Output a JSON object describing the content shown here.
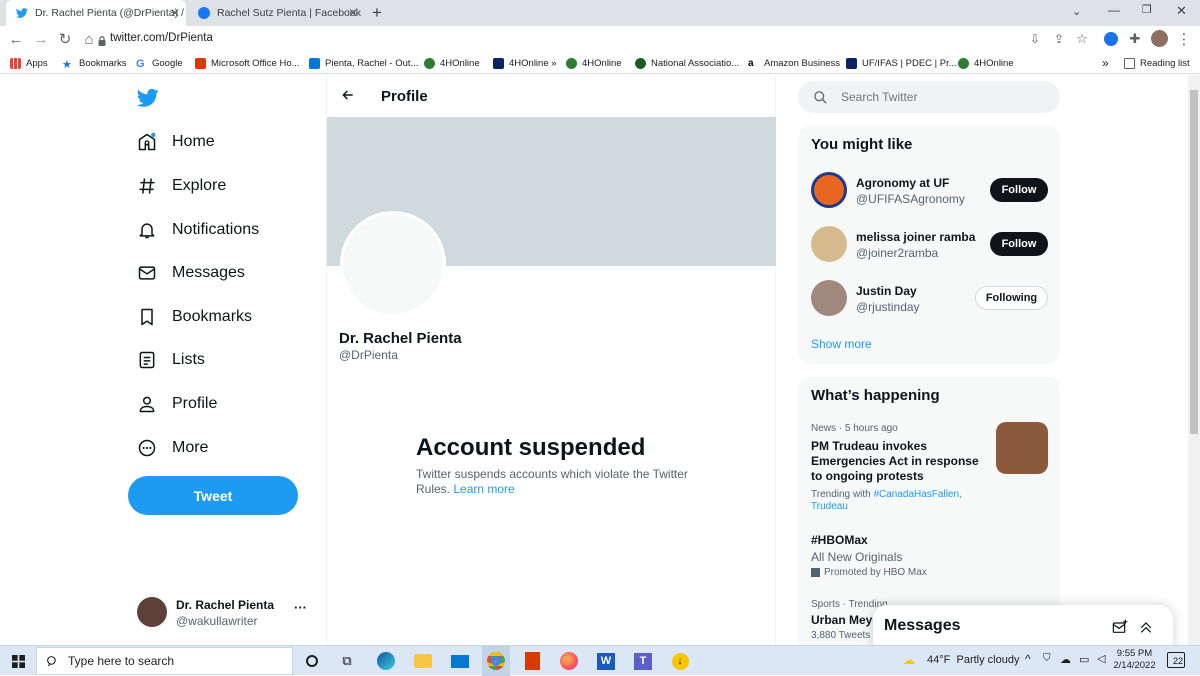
{
  "browser": {
    "tabs": [
      {
        "title": "Dr. Rachel Pienta (@DrPienta) / T",
        "icon": "twitter-icon"
      },
      {
        "title": "Rachel Sutz Pienta | Facebook",
        "icon": "facebook-icon"
      }
    ],
    "new_tab": "+",
    "url": "twitter.com/DrPienta",
    "bookmarks": [
      {
        "label": "Apps",
        "icon": "apps-grid-icon"
      },
      {
        "label": "Bookmarks",
        "icon": "star-icon"
      },
      {
        "label": "Google",
        "icon": "google-icon"
      },
      {
        "label": "Microsoft Office Ho...",
        "icon": "office-icon"
      },
      {
        "label": "Pienta, Rachel - Out...",
        "icon": "outlook-icon"
      },
      {
        "label": "4HOnline",
        "icon": "clover-icon"
      },
      {
        "label": "4HOnline »",
        "icon": "ifas-icon"
      },
      {
        "label": "4HOnline",
        "icon": "clover-icon"
      },
      {
        "label": "National Associatio...",
        "icon": "clover-icon"
      },
      {
        "label": "Amazon Business",
        "icon": "amazon-icon"
      },
      {
        "label": "UF/IFAS | PDEC | Pr...",
        "icon": "ifas-icon"
      },
      {
        "label": "4HOnline",
        "icon": "clover-icon"
      }
    ],
    "more_bookmarks": "»",
    "reading_list": "Reading list"
  },
  "sidebar": {
    "items": [
      {
        "label": "Home",
        "icon": "home-icon"
      },
      {
        "label": "Explore",
        "icon": "hashtag-icon"
      },
      {
        "label": "Notifications",
        "icon": "bell-icon"
      },
      {
        "label": "Messages",
        "icon": "envelope-icon"
      },
      {
        "label": "Bookmarks",
        "icon": "bookmark-icon"
      },
      {
        "label": "Lists",
        "icon": "list-icon"
      },
      {
        "label": "Profile",
        "icon": "person-icon"
      },
      {
        "label": "More",
        "icon": "more-circle-icon"
      }
    ],
    "tweet_label": "Tweet",
    "account": {
      "name": "Dr. Rachel Pienta",
      "handle": "@wakullawriter",
      "menu": "···"
    }
  },
  "profile": {
    "header_title": "Profile",
    "name": "Dr. Rachel Pienta",
    "handle": "@DrPienta",
    "suspended_title": "Account suspended",
    "suspended_text": "Twitter suspends accounts which violate the Twitter Rules.",
    "learn_more": "Learn more"
  },
  "search": {
    "placeholder": "Search Twitter"
  },
  "who_to_follow": {
    "title": "You might like",
    "users": [
      {
        "name": "Agronomy at UF",
        "handle": "@UFIFASAgronomy",
        "button": "Follow",
        "following": false
      },
      {
        "name": "melissa joiner ramba",
        "handle": "@joiner2ramba",
        "button": "Follow",
        "following": false
      },
      {
        "name": "Justin Day",
        "handle": "@rjustinday",
        "button": "Following",
        "following": true
      }
    ],
    "show_more": "Show more"
  },
  "trends": {
    "title": "What’s happening",
    "items": [
      {
        "meta": "News · 5 hours ago",
        "headline": "PM Trudeau invokes Emergencies Act in response to ongoing protests",
        "trending_prefix": "Trending with ",
        "trending_tags": "#CanadaHasFallen,",
        "trending_tags2": "Trudeau"
      },
      {
        "headline": "#HBOMax",
        "subtitle": "All New Originals",
        "promoted": "Promoted by HBO Max"
      },
      {
        "meta": "Sports · Trending",
        "headline": "Urban Meye",
        "count": "3,880 Tweets"
      }
    ]
  },
  "messages_drawer": {
    "title": "Messages"
  },
  "taskbar": {
    "search_placeholder": "Type here to search",
    "weather_temp": "44°F",
    "weather_desc": "Partly cloudy",
    "time": "9:55 PM",
    "date": "2/14/2022",
    "notifications_count": "22"
  },
  "colors": {
    "twitter_blue": "#1d9bf0",
    "banner": "#cfd9de",
    "taskbar": "#dbe7f4"
  }
}
